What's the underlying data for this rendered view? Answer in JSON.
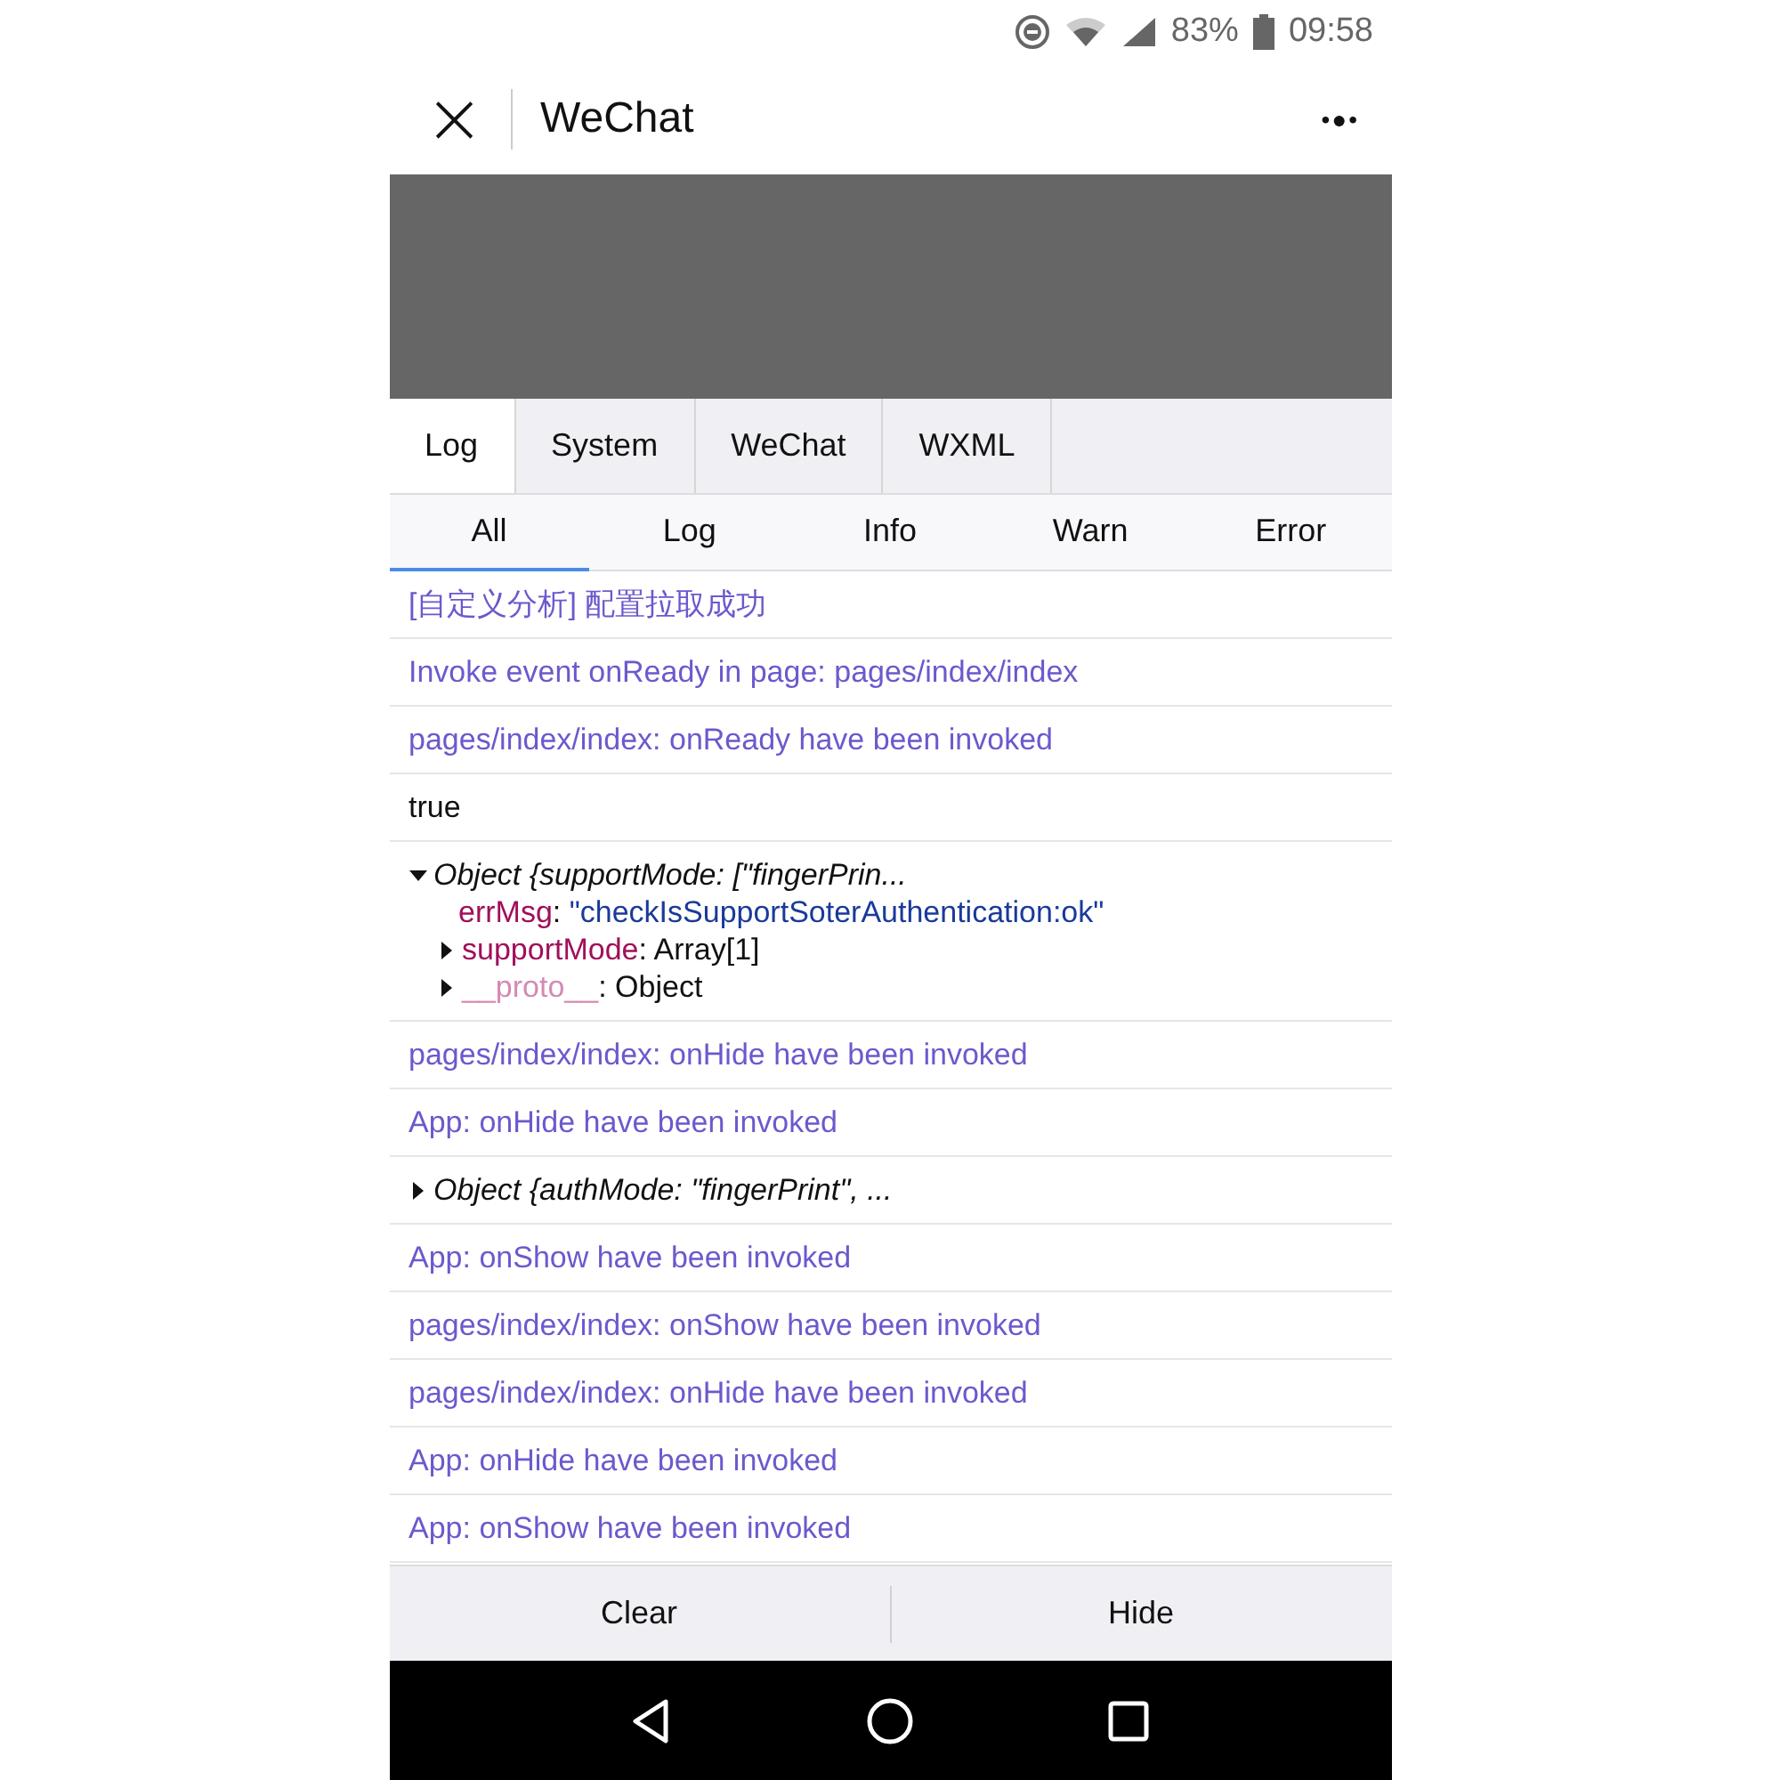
{
  "status_bar": {
    "battery": "83%",
    "time": "09:58"
  },
  "header": {
    "close": "×",
    "title": "WeChat",
    "more": "•●•"
  },
  "tabs": [
    {
      "label": "Log",
      "selected": true
    },
    {
      "label": "System",
      "selected": false
    },
    {
      "label": "WeChat",
      "selected": false
    },
    {
      "label": "WXML",
      "selected": false
    }
  ],
  "filters": [
    {
      "label": "All",
      "selected": true
    },
    {
      "label": "Log",
      "selected": false
    },
    {
      "label": "Info",
      "selected": false
    },
    {
      "label": "Warn",
      "selected": false
    },
    {
      "label": "Error",
      "selected": false
    }
  ],
  "entries": [
    {
      "kind": "info",
      "text": "[自定义分析] 配置拉取成功"
    },
    {
      "kind": "info",
      "text": "Invoke event onReady in page: pages/index/index"
    },
    {
      "kind": "info",
      "text": "pages/index/index: onReady have been invoked"
    },
    {
      "kind": "log",
      "text": "true"
    },
    {
      "kind": "object",
      "summary": "Object {supportMode: [\"fingerPrin...",
      "expanded": true,
      "properties": [
        {
          "key": "errMsg",
          "separator": ":",
          "value": "\"checkIsSupportSoterAuthentication:ok\"",
          "kind": "string",
          "expandable": false
        },
        {
          "key": "supportMode",
          "separator": ":",
          "value": "Array[1]",
          "kind": "plain",
          "expandable": true
        },
        {
          "key": "__proto__",
          "separator": ":",
          "value": "Object",
          "kind": "internal",
          "expandable": true
        }
      ]
    },
    {
      "kind": "info",
      "text": "pages/index/index: onHide have been invoked"
    },
    {
      "kind": "info",
      "text": "App: onHide have been invoked"
    },
    {
      "kind": "object",
      "summary": "Object {authMode: \"fingerPrint\", ...",
      "expanded": false
    },
    {
      "kind": "info",
      "text": "App: onShow have been invoked"
    },
    {
      "kind": "info",
      "text": "pages/index/index: onShow have been invoked"
    },
    {
      "kind": "info",
      "text": "pages/index/index: onHide have been invoked"
    },
    {
      "kind": "info",
      "text": "App: onHide have been invoked"
    },
    {
      "kind": "info",
      "text": "App: onShow have been invoked"
    }
  ],
  "buttons": [
    "Clear",
    "Hide"
  ]
}
